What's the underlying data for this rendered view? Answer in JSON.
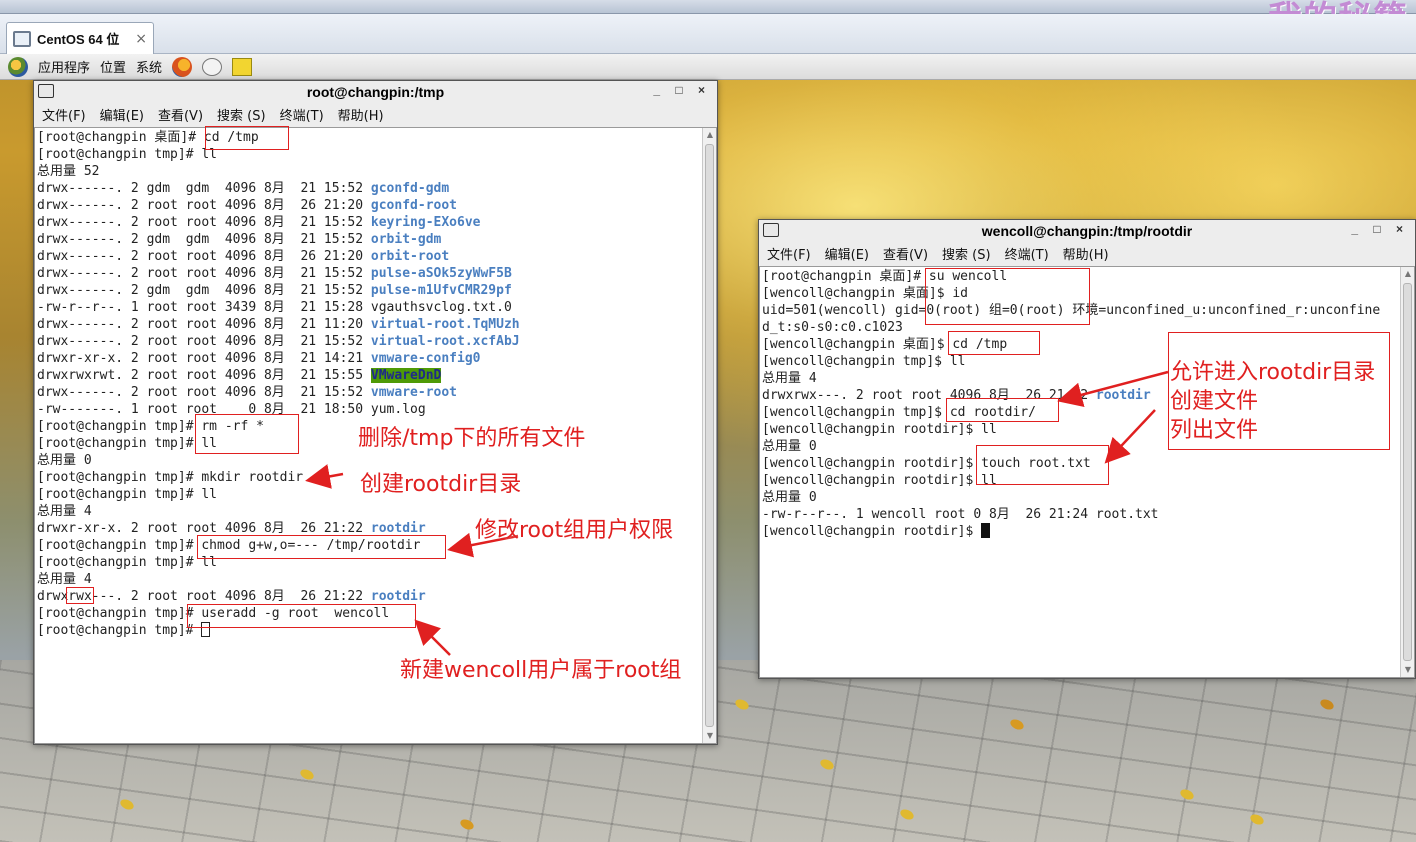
{
  "watermark": "我的秘籍",
  "vm_tab": {
    "label": "CentOS 64 位",
    "close": "×"
  },
  "panel": {
    "apps": "应用程序",
    "places": "位置",
    "system": "系统"
  },
  "left_term": {
    "title": "root@changpin:/tmp",
    "menu": [
      "文件(F)",
      "编辑(E)",
      "查看(V)",
      "搜索 (S)",
      "终端(T)",
      "帮助(H)"
    ],
    "lines": [
      [
        {
          "t": "[root@changpin 桌面]# cd /tmp"
        }
      ],
      [
        {
          "t": "[root@changpin tmp]# ll"
        }
      ],
      [
        {
          "t": "总用量 52"
        }
      ],
      [
        {
          "t": "drwx------. 2 gdm  gdm  4096 8月  21 15:52 "
        },
        {
          "t": "gconfd-gdm",
          "c": "blue"
        }
      ],
      [
        {
          "t": "drwx------. 2 root root 4096 8月  26 21:20 "
        },
        {
          "t": "gconfd-root",
          "c": "blue"
        }
      ],
      [
        {
          "t": "drwx------. 2 root root 4096 8月  21 15:52 "
        },
        {
          "t": "keyring-EXo6ve",
          "c": "blue"
        }
      ],
      [
        {
          "t": "drwx------. 2 gdm  gdm  4096 8月  21 15:52 "
        },
        {
          "t": "orbit-gdm",
          "c": "blue"
        }
      ],
      [
        {
          "t": "drwx------. 2 root root 4096 8月  26 21:20 "
        },
        {
          "t": "orbit-root",
          "c": "blue"
        }
      ],
      [
        {
          "t": "drwx------. 2 root root 4096 8月  21 15:52 "
        },
        {
          "t": "pulse-aSOk5zyWwF5B",
          "c": "blue"
        }
      ],
      [
        {
          "t": "drwx------. 2 gdm  gdm  4096 8月  21 15:52 "
        },
        {
          "t": "pulse-m1UfvCMR29pf",
          "c": "blue"
        }
      ],
      [
        {
          "t": "-rw-r--r--. 1 root root 3439 8月  21 15:28 vgauthsvclog.txt.0"
        }
      ],
      [
        {
          "t": "drwx------. 2 root root 4096 8月  21 11:20 "
        },
        {
          "t": "virtual-root.TqMUzh",
          "c": "blue"
        }
      ],
      [
        {
          "t": "drwx------. 2 root root 4096 8月  21 15:52 "
        },
        {
          "t": "virtual-root.xcfAbJ",
          "c": "blue"
        }
      ],
      [
        {
          "t": "drwxr-xr-x. 2 root root 4096 8月  21 14:21 "
        },
        {
          "t": "vmware-config0",
          "c": "blue"
        }
      ],
      [
        {
          "t": "drwxrwxrwt. 2 root root 4096 8月  21 15:55 "
        },
        {
          "t": "VMwareDnD",
          "c": "green-bg"
        }
      ],
      [
        {
          "t": "drwx------. 2 root root 4096 8月  21 15:52 "
        },
        {
          "t": "vmware-root",
          "c": "blue"
        }
      ],
      [
        {
          "t": "-rw-------. 1 root root    0 8月  21 18:50 yum.log"
        }
      ],
      [
        {
          "t": "[root@changpin tmp]# rm -rf *"
        }
      ],
      [
        {
          "t": "[root@changpin tmp]# ll"
        }
      ],
      [
        {
          "t": "总用量 0"
        }
      ],
      [
        {
          "t": "[root@changpin tmp]# mkdir rootdir"
        }
      ],
      [
        {
          "t": "[root@changpin tmp]# ll"
        }
      ],
      [
        {
          "t": "总用量 4"
        }
      ],
      [
        {
          "t": "drwxr-xr-x. 2 root root 4096 8月  26 21:22 "
        },
        {
          "t": "rootdir",
          "c": "blue"
        }
      ],
      [
        {
          "t": "[root@changpin tmp]# chmod g+w,o=--- /tmp/rootdir"
        }
      ],
      [
        {
          "t": "[root@changpin tmp]# ll"
        }
      ],
      [
        {
          "t": "总用量 4"
        }
      ],
      [
        {
          "t": "drwxrwx---. 2 root root 4096 8月  26 21:22 "
        },
        {
          "t": "rootdir",
          "c": "blue"
        }
      ],
      [
        {
          "t": "[root@changpin tmp]# useradd -g root  wencoll"
        }
      ],
      [
        {
          "t": "[root@changpin tmp]# "
        },
        {
          "t": "",
          "c": "cursor hollow"
        }
      ]
    ]
  },
  "right_term": {
    "title": "wencoll@changpin:/tmp/rootdir",
    "menu": [
      "文件(F)",
      "编辑(E)",
      "查看(V)",
      "搜索 (S)",
      "终端(T)",
      "帮助(H)"
    ],
    "lines": [
      [
        {
          "t": "[root@changpin 桌面]# su wencoll"
        }
      ],
      [
        {
          "t": "[wencoll@changpin 桌面]$ id"
        }
      ],
      [
        {
          "t": "uid=501(wencoll) gid=0(root) 组=0(root) 环境=unconfined_u:unconfined_r:unconfine"
        }
      ],
      [
        {
          "t": "d_t:s0-s0:c0.c1023"
        }
      ],
      [
        {
          "t": "[wencoll@changpin 桌面]$ cd /tmp"
        }
      ],
      [
        {
          "t": "[wencoll@changpin tmp]$ ll"
        }
      ],
      [
        {
          "t": "总用量 4"
        }
      ],
      [
        {
          "t": "drwxrwx---. 2 root root 4096 8月  26 21:22 "
        },
        {
          "t": "rootdir",
          "c": "blue"
        }
      ],
      [
        {
          "t": "[wencoll@changpin tmp]$ cd rootdir/"
        }
      ],
      [
        {
          "t": "[wencoll@changpin rootdir]$ ll"
        }
      ],
      [
        {
          "t": "总用量 0"
        }
      ],
      [
        {
          "t": "[wencoll@changpin rootdir]$ touch root.txt"
        }
      ],
      [
        {
          "t": "[wencoll@changpin rootdir]$ ll"
        }
      ],
      [
        {
          "t": "总用量 0"
        }
      ],
      [
        {
          "t": "-rw-r--r--. 1 wencoll root 0 8月  26 21:24 root.txt"
        }
      ],
      [
        {
          "t": "[wencoll@changpin rootdir]$ "
        },
        {
          "t": "",
          "c": "cursor solid"
        }
      ]
    ]
  },
  "annotations": {
    "delete_all": "删除/tmp下的所有文件",
    "create_dir": "创建rootdir目录",
    "modify_perm": "修改root组用户权限",
    "new_user": "新建wencoll用户属于root组",
    "allow_enter": "允许进入rootdir目录",
    "create_file": "创建文件",
    "list_files": "列出文件"
  },
  "colors": {
    "annotation": "#e02020",
    "dir_blue": "#4a7fc0",
    "sticky_bg": "#4e9a06"
  }
}
